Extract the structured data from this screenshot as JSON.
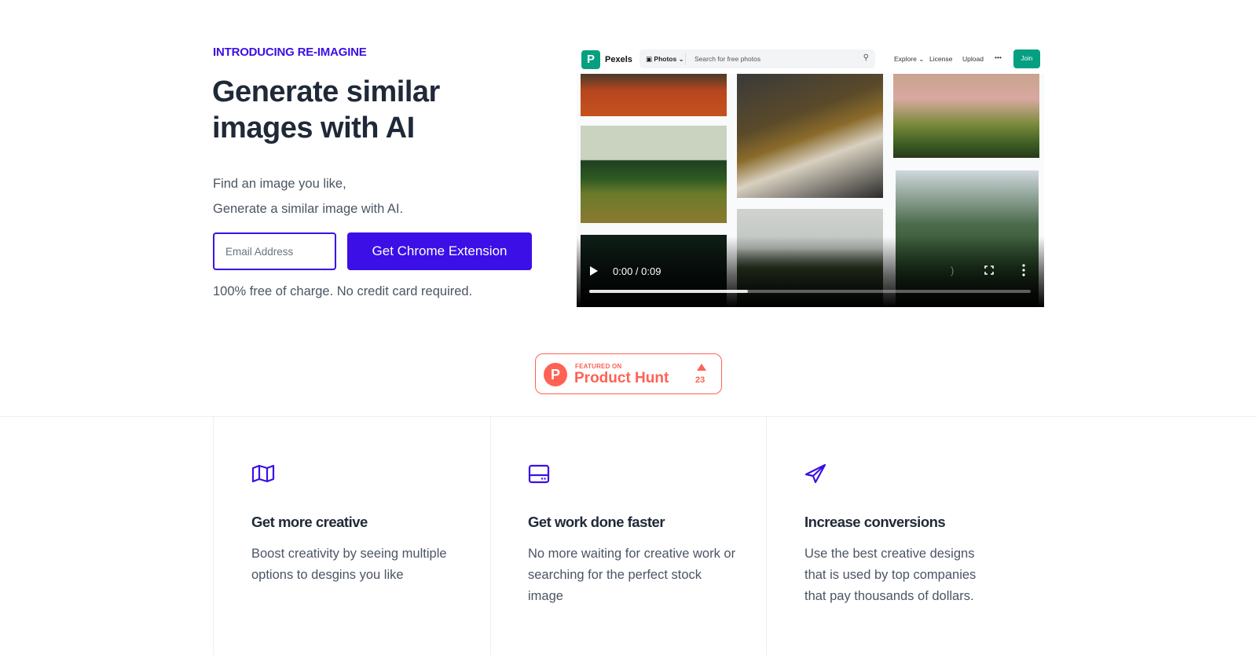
{
  "hero": {
    "eyebrow": "INTRODUCING RE-IMAGINE",
    "headline": "Generate similar images with AI",
    "sublines": [
      "Find an image you like,",
      "Generate a similar image with AI."
    ],
    "email_placeholder": "Email Address",
    "cta_label": "Get Chrome Extension",
    "note": "100% free of charge. No credit card required."
  },
  "video": {
    "site": {
      "name": "Pexels",
      "logo_letter": "P",
      "category": "Photos",
      "search_placeholder": "Search for free photos",
      "nav": [
        "Explore",
        "License",
        "Upload",
        "•••"
      ],
      "join_label": "Join"
    },
    "time_display": "0:00 / 0:09",
    "buffered_fraction": 0.36,
    "icons": {
      "play": "play-icon",
      "volume": "volume-icon",
      "fullscreen": "fullscreen-icon",
      "more": "more-vertical-icon"
    }
  },
  "product_hunt": {
    "featured_on": "FEATURED ON",
    "name": "Product Hunt",
    "logo_letter": "P",
    "upvotes": "23"
  },
  "features": [
    {
      "icon": "map-icon",
      "title": "Get more creative",
      "description": "Boost creativity by seeing multiple options to desgins you like"
    },
    {
      "icon": "server-icon",
      "title": "Get work done faster",
      "description": "No more waiting for creative work or searching for the perfect stock image"
    },
    {
      "icon": "paper-plane-icon",
      "title": "Increase conversions",
      "description": "Use the best creative designs that is used by top companies that pay thousands of dollars."
    }
  ],
  "colors": {
    "accent": "#3b0fe6",
    "heading": "#1f2937",
    "body": "#4b5563",
    "product_hunt": "#ff6154",
    "pexels": "#05a081"
  }
}
